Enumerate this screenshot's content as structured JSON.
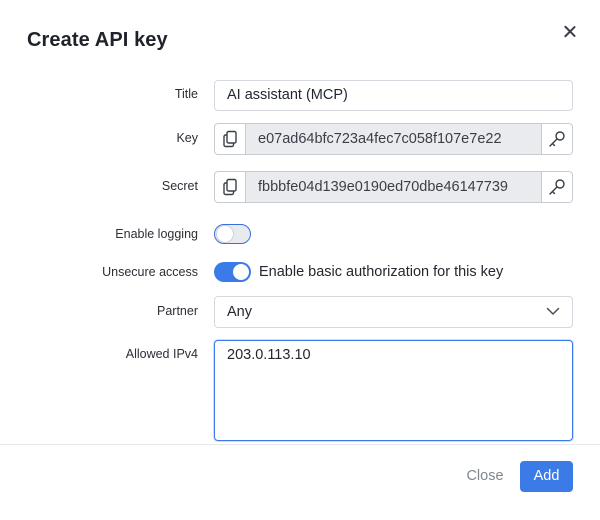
{
  "dialog": {
    "title": "Create API key"
  },
  "fields": {
    "title": {
      "label": "Title",
      "value": "AI assistant (MCP)"
    },
    "key": {
      "label": "Key",
      "value": "e07ad64bfc723a4fec7c058f107e7e22"
    },
    "secret": {
      "label": "Secret",
      "value": "fbbbfe04d139e0190ed70dbe46147739"
    },
    "enable_logging": {
      "label": "Enable logging",
      "checked": false
    },
    "unsecure_access": {
      "label": "Unsecure access",
      "checked": true,
      "text": "Enable basic authorization for this key"
    },
    "partner": {
      "label": "Partner",
      "value": "Any"
    },
    "allowed_ipv4": {
      "label": "Allowed IPv4",
      "value": "203.0.113.10"
    }
  },
  "footer": {
    "close_label": "Close",
    "add_label": "Add"
  },
  "icons": {
    "copy": "copy-icon",
    "generate": "key-icon",
    "close": "close-icon",
    "dropdown": "chevron-down-icon"
  },
  "colors": {
    "accent": "#3b7be8",
    "readonly_bg": "#e9ebee"
  }
}
